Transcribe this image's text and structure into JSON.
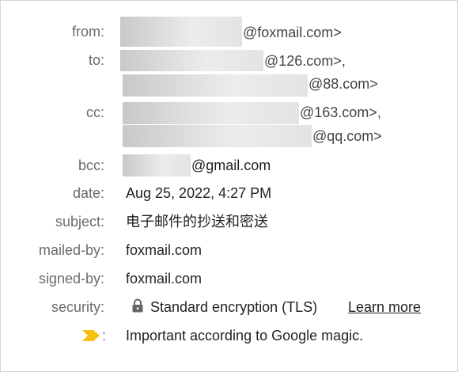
{
  "labels": {
    "from": "from:",
    "to": "to:",
    "cc": "cc:",
    "bcc": "bcc:",
    "date": "date:",
    "subject": "subject:",
    "mailed_by": "mailed-by:",
    "signed_by": "signed-by:",
    "security": "security:",
    "importance_colon": ":"
  },
  "from": {
    "domain": "@foxmail.com>"
  },
  "to": [
    {
      "domain": "@126.com>,"
    },
    {
      "domain": "@88.com>"
    }
  ],
  "cc": [
    {
      "domain": "@163.com>,"
    },
    {
      "domain": "@qq.com>"
    }
  ],
  "bcc": {
    "domain": "@gmail.com"
  },
  "date": "Aug 25, 2022, 4:27 PM",
  "subject": "电子邮件的抄送和密送",
  "mailed_by": "foxmail.com",
  "signed_by": "foxmail.com",
  "security": {
    "text": "Standard encryption (TLS)",
    "link": "Learn more",
    "icon": "lock-icon"
  },
  "importance": {
    "text": "Important according to Google magic.",
    "icon": "importance-marker-icon",
    "color": "#f4c20d"
  }
}
